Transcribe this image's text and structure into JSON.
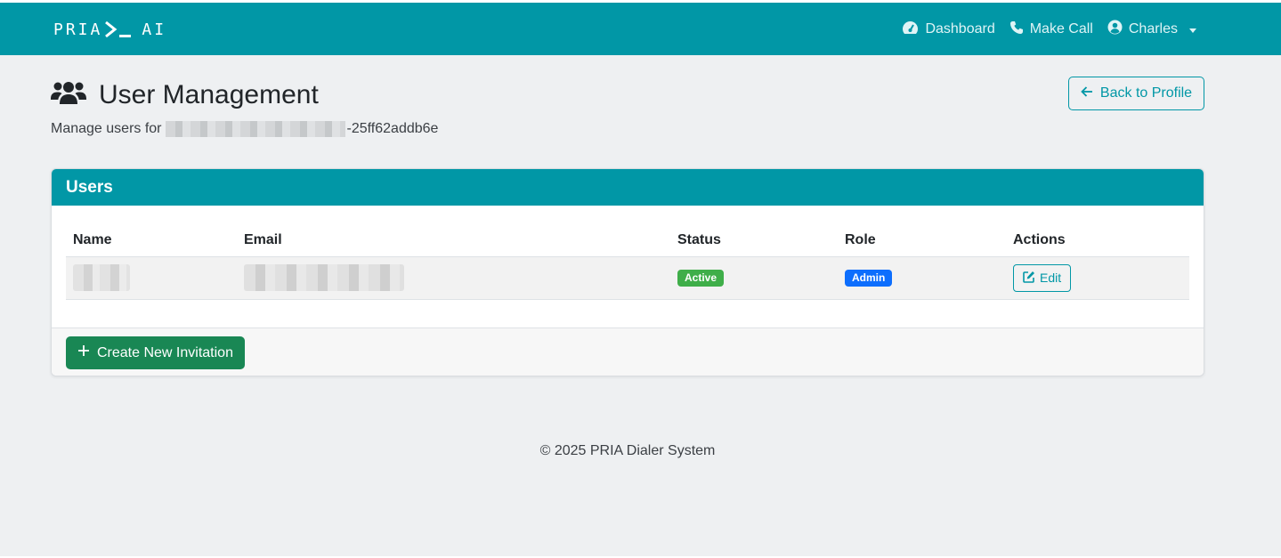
{
  "navbar": {
    "logo_left": "PRIA",
    "logo_right": "AI",
    "links": [
      {
        "label": "Dashboard",
        "icon": "dashboard-gauge-icon"
      },
      {
        "label": "Make Call",
        "icon": "phone-icon"
      },
      {
        "label": "Charles",
        "icon": "user-circle-icon"
      }
    ]
  },
  "header": {
    "title": "User Management",
    "subtitle_prefix": "Manage users for",
    "subtitle_suffix": "-25ff62addb6e",
    "back_label": "Back to Profile"
  },
  "users_card": {
    "title": "Users",
    "columns": [
      "Name",
      "Email",
      "Status",
      "Role",
      "Actions"
    ],
    "rows": [
      {
        "status": "Active",
        "role": "Admin",
        "action": "Edit"
      }
    ],
    "create_label": "Create New Invitation"
  },
  "footer": {
    "text": "© 2025 PRIA Dialer System"
  },
  "colors": {
    "brand": "#0197a6",
    "success": "#198754",
    "active_badge": "#3fae49",
    "admin_badge": "#0d6efd"
  }
}
